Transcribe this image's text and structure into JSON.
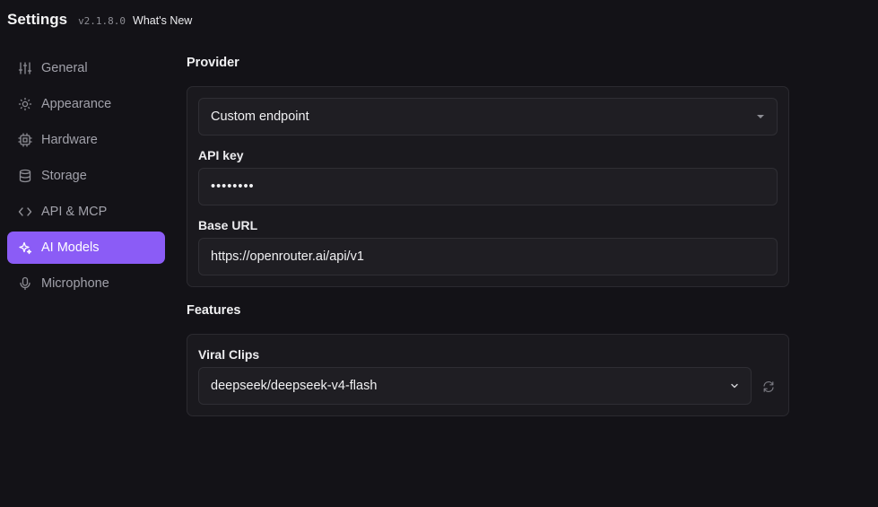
{
  "header": {
    "title": "Settings",
    "version": "v2.1.8.0",
    "whats_new": "What's New"
  },
  "sidebar": {
    "items": [
      {
        "label": "General",
        "icon": "sliders-icon"
      },
      {
        "label": "Appearance",
        "icon": "sun-icon"
      },
      {
        "label": "Hardware",
        "icon": "cpu-icon"
      },
      {
        "label": "Storage",
        "icon": "database-icon"
      },
      {
        "label": "API & MCP",
        "icon": "code-icon"
      },
      {
        "label": "AI Models",
        "icon": "sparkles-icon",
        "active": true
      },
      {
        "label": "Microphone",
        "icon": "microphone-icon"
      }
    ]
  },
  "provider": {
    "section_title": "Provider",
    "provider_select": "Custom endpoint",
    "api_key_label": "API key",
    "api_key_value": "••••••••",
    "base_url_label": "Base URL",
    "base_url_value": "https://openrouter.ai/api/v1"
  },
  "features": {
    "section_title": "Features",
    "viral_clips_label": "Viral Clips",
    "viral_clips_model": "deepseek/deepseek-v4-flash"
  },
  "colors": {
    "accent": "#8b5cf6",
    "background": "#131217",
    "card": "#1a191e"
  }
}
